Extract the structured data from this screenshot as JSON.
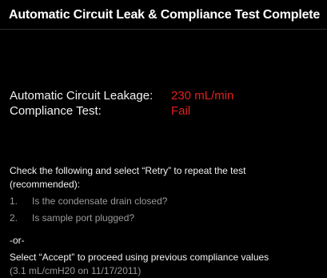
{
  "header": {
    "title": "Automatic Circuit Leak & Compliance Test Complete"
  },
  "results": [
    {
      "label": "Automatic Circuit Leakage:",
      "value": "230 mL/min"
    },
    {
      "label": "Compliance Test:",
      "value": "Fail"
    }
  ],
  "instructions": {
    "line1": "Check the following and select “Retry” to repeat the test",
    "line2": "(recommended):",
    "items": [
      {
        "number": "1.",
        "text": "Is the condensate drain closed?"
      },
      {
        "number": "2.",
        "text": "Is sample port plugged?"
      }
    ],
    "or": "-or-",
    "accept_line1": "Select “Accept” to proceed using previous compliance values",
    "accept_line2": "(3.1 mL/cmH20 on 11/17/2011)"
  },
  "colors": {
    "background": "#000000",
    "text": "#f2f2f2",
    "muted_text": "#9a9a9a",
    "alert": "#e0201c"
  }
}
